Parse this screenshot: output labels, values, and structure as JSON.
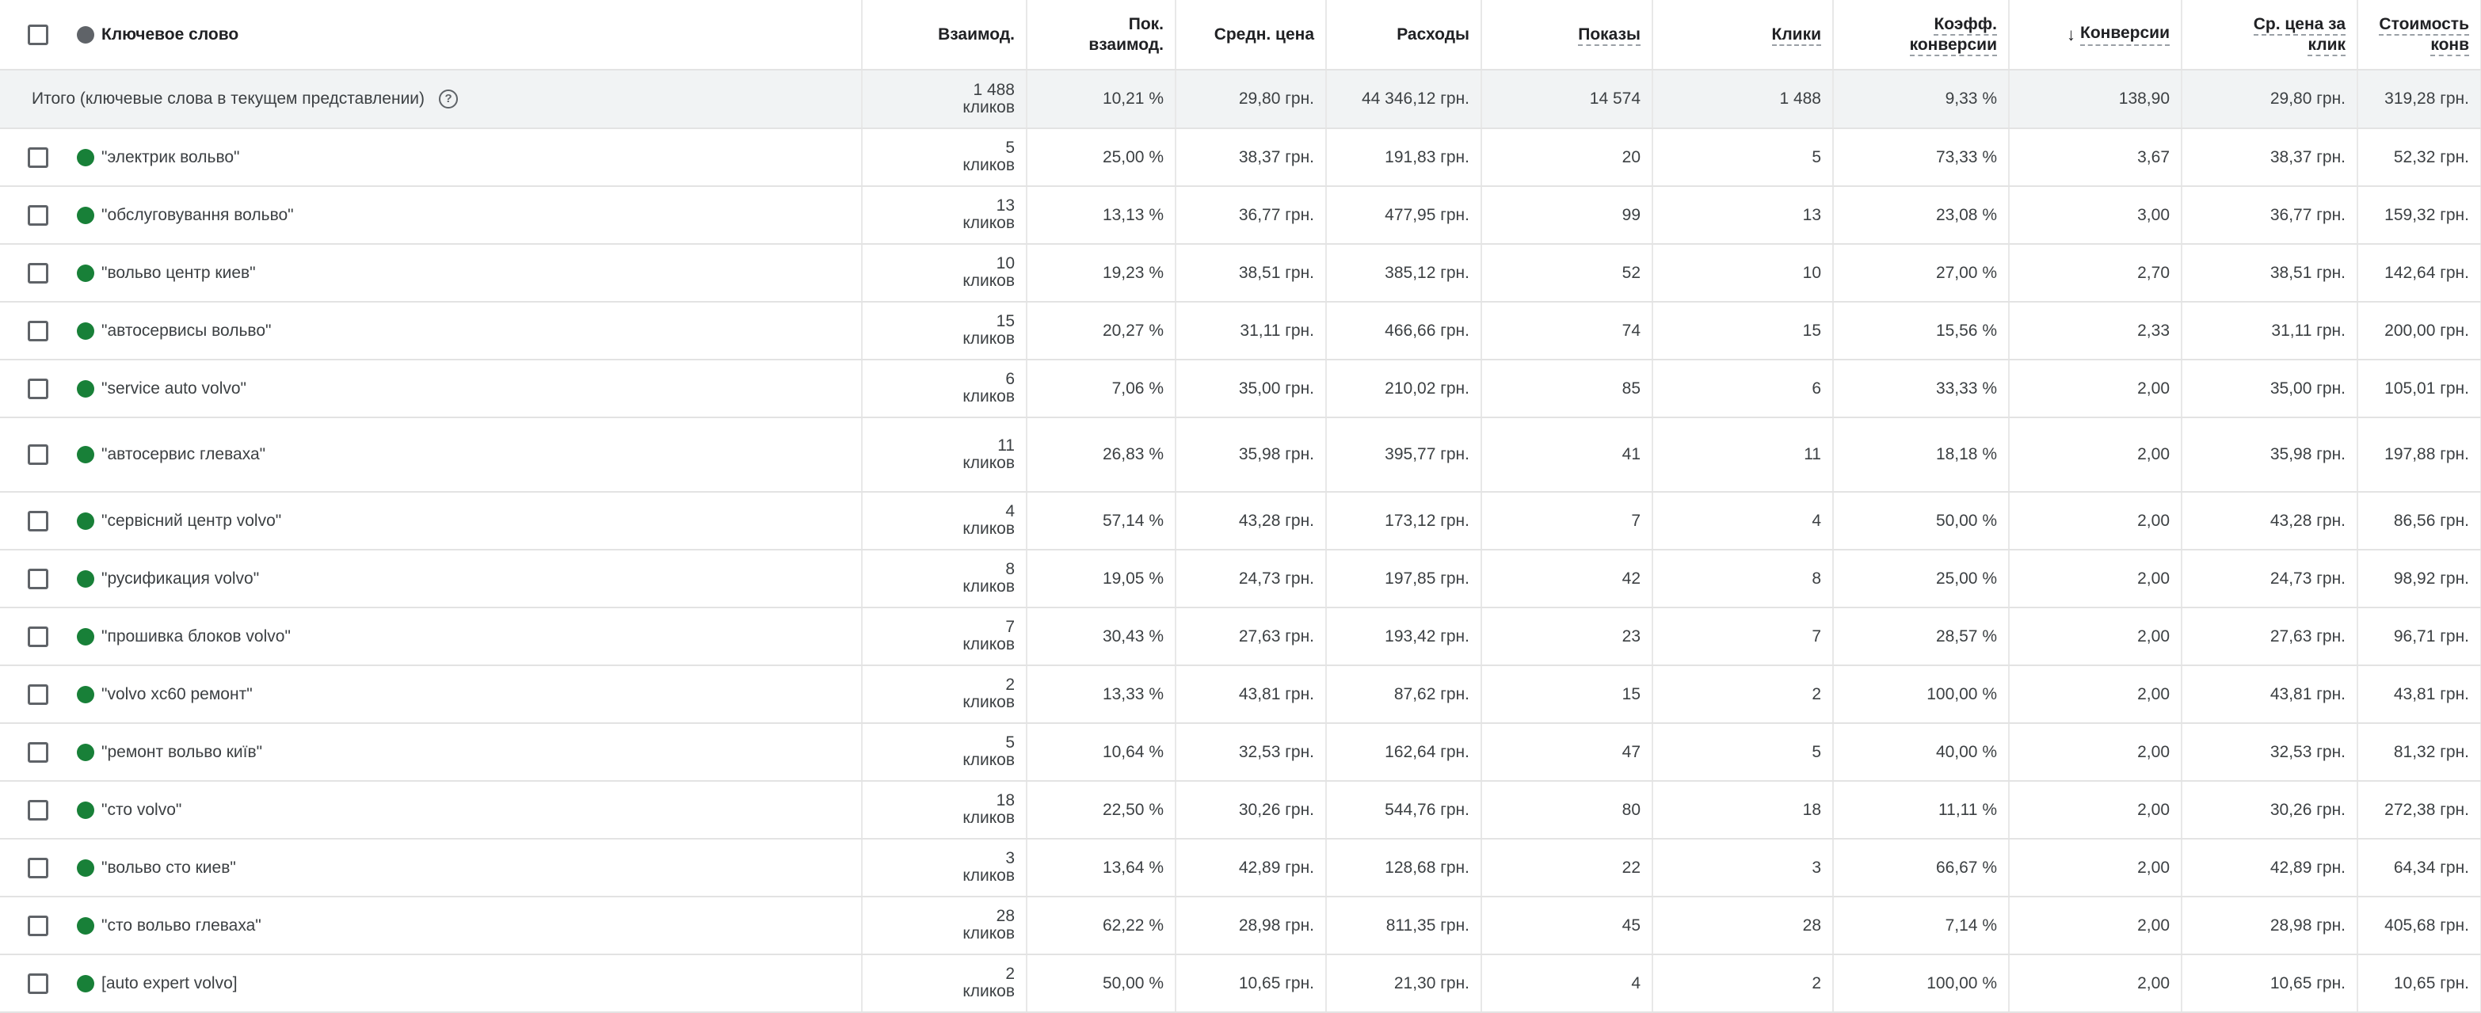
{
  "columns": {
    "keyword": "Ключевое слово",
    "interactions": "Взаимод.",
    "interaction_rate_l1": "Пок.",
    "interaction_rate_l2": "взаимод.",
    "avg_cost": "Средн. цена",
    "cost": "Расходы",
    "impressions": "Показы",
    "clicks": "Клики",
    "conv_rate_l1": "Коэфф.",
    "conv_rate_l2": "конверсии",
    "conversions": "Конверсии",
    "avg_cpc_l1": "Ср. цена за",
    "avg_cpc_l2": "клик",
    "cost_conv_l1": "Стоимость",
    "cost_conv_l2": "конв"
  },
  "sort_icon": "arrow-down-icon",
  "colors": {
    "status_enabled": "#188038",
    "header_status": "#5f6368",
    "total_bg": "#f1f3f4"
  },
  "totals": {
    "label": "Итого (ключевые слова в текущем представлении)",
    "interactions_num": "1 488",
    "interactions_unit": "кликов",
    "interaction_rate": "10,21 %",
    "avg_cost": "29,80 грн.",
    "cost": "44 346,12 грн.",
    "impressions": "14 574",
    "clicks": "1 488",
    "conv_rate": "9,33 %",
    "conversions": "138,90",
    "avg_cpc": "29,80 грн.",
    "cost_conv": "319,28 грн."
  },
  "rows": [
    {
      "keyword": "\"электрик вольво\"",
      "interactions_num": "5",
      "interactions_unit": "кликов",
      "interaction_rate": "25,00 %",
      "avg_cost": "38,37 грн.",
      "cost": "191,83 грн.",
      "impressions": "20",
      "clicks": "5",
      "conv_rate": "73,33 %",
      "conversions": "3,67",
      "avg_cpc": "38,37 грн.",
      "cost_conv": "52,32 грн."
    },
    {
      "keyword": "\"обслуговування вольво\"",
      "interactions_num": "13",
      "interactions_unit": "кликов",
      "interaction_rate": "13,13 %",
      "avg_cost": "36,77 грн.",
      "cost": "477,95 грн.",
      "impressions": "99",
      "clicks": "13",
      "conv_rate": "23,08 %",
      "conversions": "3,00",
      "avg_cpc": "36,77 грн.",
      "cost_conv": "159,32 грн."
    },
    {
      "keyword": "\"вольво центр киев\"",
      "interactions_num": "10",
      "interactions_unit": "кликов",
      "interaction_rate": "19,23 %",
      "avg_cost": "38,51 грн.",
      "cost": "385,12 грн.",
      "impressions": "52",
      "clicks": "10",
      "conv_rate": "27,00 %",
      "conversions": "2,70",
      "avg_cpc": "38,51 грн.",
      "cost_conv": "142,64 грн."
    },
    {
      "keyword": "\"автосервисы вольво\"",
      "interactions_num": "15",
      "interactions_unit": "кликов",
      "interaction_rate": "20,27 %",
      "avg_cost": "31,11 грн.",
      "cost": "466,66 грн.",
      "impressions": "74",
      "clicks": "15",
      "conv_rate": "15,56 %",
      "conversions": "2,33",
      "avg_cpc": "31,11 грн.",
      "cost_conv": "200,00 грн."
    },
    {
      "keyword": "\"service auto volvo\"",
      "interactions_num": "6",
      "interactions_unit": "кликов",
      "interaction_rate": "7,06 %",
      "avg_cost": "35,00 грн.",
      "cost": "210,02 грн.",
      "impressions": "85",
      "clicks": "6",
      "conv_rate": "33,33 %",
      "conversions": "2,00",
      "avg_cpc": "35,00 грн.",
      "cost_conv": "105,01 грн."
    },
    {
      "keyword": "\"автосервис глеваха\"",
      "interactions_num": "11",
      "interactions_unit": "кликов",
      "interaction_rate": "26,83 %",
      "avg_cost": "35,98 грн.",
      "cost": "395,77 грн.",
      "impressions": "41",
      "clicks": "11",
      "conv_rate": "18,18 %",
      "conversions": "2,00",
      "avg_cpc": "35,98 грн.",
      "cost_conv": "197,88 грн."
    },
    {
      "keyword": "\"сервісний центр volvo\"",
      "interactions_num": "4",
      "interactions_unit": "кликов",
      "interaction_rate": "57,14 %",
      "avg_cost": "43,28 грн.",
      "cost": "173,12 грн.",
      "impressions": "7",
      "clicks": "4",
      "conv_rate": "50,00 %",
      "conversions": "2,00",
      "avg_cpc": "43,28 грн.",
      "cost_conv": "86,56 грн."
    },
    {
      "keyword": "\"русификация volvo\"",
      "interactions_num": "8",
      "interactions_unit": "кликов",
      "interaction_rate": "19,05 %",
      "avg_cost": "24,73 грн.",
      "cost": "197,85 грн.",
      "impressions": "42",
      "clicks": "8",
      "conv_rate": "25,00 %",
      "conversions": "2,00",
      "avg_cpc": "24,73 грн.",
      "cost_conv": "98,92 грн."
    },
    {
      "keyword": "\"прошивка блоков volvo\"",
      "interactions_num": "7",
      "interactions_unit": "кликов",
      "interaction_rate": "30,43 %",
      "avg_cost": "27,63 грн.",
      "cost": "193,42 грн.",
      "impressions": "23",
      "clicks": "7",
      "conv_rate": "28,57 %",
      "conversions": "2,00",
      "avg_cpc": "27,63 грн.",
      "cost_conv": "96,71 грн."
    },
    {
      "keyword": "\"volvo xc60 ремонт\"",
      "interactions_num": "2",
      "interactions_unit": "кликов",
      "interaction_rate": "13,33 %",
      "avg_cost": "43,81 грн.",
      "cost": "87,62 грн.",
      "impressions": "15",
      "clicks": "2",
      "conv_rate": "100,00 %",
      "conversions": "2,00",
      "avg_cpc": "43,81 грн.",
      "cost_conv": "43,81 грн."
    },
    {
      "keyword": "\"ремонт вольво київ\"",
      "interactions_num": "5",
      "interactions_unit": "кликов",
      "interaction_rate": "10,64 %",
      "avg_cost": "32,53 грн.",
      "cost": "162,64 грн.",
      "impressions": "47",
      "clicks": "5",
      "conv_rate": "40,00 %",
      "conversions": "2,00",
      "avg_cpc": "32,53 грн.",
      "cost_conv": "81,32 грн."
    },
    {
      "keyword": "\"сто volvo\"",
      "interactions_num": "18",
      "interactions_unit": "кликов",
      "interaction_rate": "22,50 %",
      "avg_cost": "30,26 грн.",
      "cost": "544,76 грн.",
      "impressions": "80",
      "clicks": "18",
      "conv_rate": "11,11 %",
      "conversions": "2,00",
      "avg_cpc": "30,26 грн.",
      "cost_conv": "272,38 грн."
    },
    {
      "keyword": "\"вольво сто киев\"",
      "interactions_num": "3",
      "interactions_unit": "кликов",
      "interaction_rate": "13,64 %",
      "avg_cost": "42,89 грн.",
      "cost": "128,68 грн.",
      "impressions": "22",
      "clicks": "3",
      "conv_rate": "66,67 %",
      "conversions": "2,00",
      "avg_cpc": "42,89 грн.",
      "cost_conv": "64,34 грн."
    },
    {
      "keyword": "\"сто вольво глеваха\"",
      "interactions_num": "28",
      "interactions_unit": "кликов",
      "interaction_rate": "62,22 %",
      "avg_cost": "28,98 грн.",
      "cost": "811,35 грн.",
      "impressions": "45",
      "clicks": "28",
      "conv_rate": "7,14 %",
      "conversions": "2,00",
      "avg_cpc": "28,98 грн.",
      "cost_conv": "405,68 грн."
    },
    {
      "keyword": "[auto expert volvo]",
      "interactions_num": "2",
      "interactions_unit": "кликов",
      "interaction_rate": "50,00 %",
      "avg_cost": "10,65 грн.",
      "cost": "21,30 грн.",
      "impressions": "4",
      "clicks": "2",
      "conv_rate": "100,00 %",
      "conversions": "2,00",
      "avg_cpc": "10,65 грн.",
      "cost_conv": "10,65 грн."
    }
  ]
}
